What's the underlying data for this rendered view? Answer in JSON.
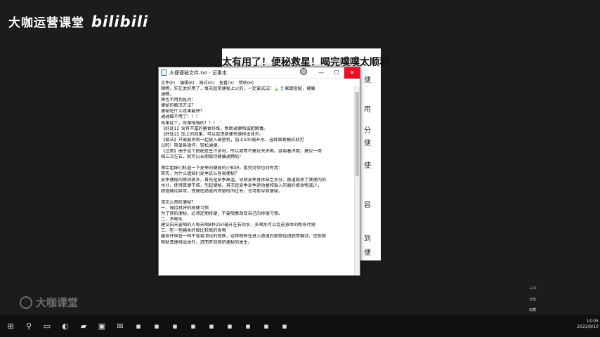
{
  "brand": {
    "channel": "大咖运营课堂",
    "site": "bilibili"
  },
  "background_doc": {
    "title": "太有用了！便秘救星！喝完噗噗太顺利",
    "side_chars": [
      "便",
      "用",
      "分",
      "便",
      "使",
      "容",
      "到",
      "便"
    ]
  },
  "notepad": {
    "title": "大便便秘文件.txt - 记事本",
    "window_controls": [
      "—",
      "☐",
      "✕"
    ],
    "menu": [
      "文件(F)",
      "编辑(E)",
      "格式(O)",
      "查看(V)",
      "帮助(H)"
    ],
    "lines": [
      "顺畅，实在太好用了，每天超常便秘上火的，一定要试试！🍃🥤果蔬搭配，健康",
      "通畅。",
      "再也不用到处问：",
      "便秘的解决方法？",
      "便秘吃什么效果最快？",
      "通通都不用了！！！",
      "效果这个，效果嘎嘎的！！！",
      "【好处1】含有不富的膳食纤维，帮助通便和减肥解毒。",
      "【好处2】加上的效果，可以促进肠便快速排出体外。",
      "【做法】只需要将和一起放入破壁机，加上500毫升水，选择果蔬模式就可",
      "以啦！简单易操作，轻松通便。",
      "【注意】由于这个搭配是生冷食材，所以肠胃不建议天天喝，容易着凉哦，建议一周",
      "喝三次左右，就可以长期保持健康通畅啦！",
      "",
      "再给姐妹们科普一下夏季的便秘的小知识，看完对你也对有用：",
      "首先，为什么姐妹们夏季这么容易便秘？",
      "夏季便秘的原因很多，首先是夏季高温，导致夏季身体缺乏水分，肠道吸收了粪便内的",
      "水分，使得粪便干结，引起便秘。其次是夏季夏季运动量和摄入的高纤维食物减少，",
      "肠道蠕动异常，粪便在肠道内停留时间过长，也可能导致便秘。",
      "",
      "该怎么预防便秘？",
      "一、保持良好的排便习惯",
      "为了预防便秘，必须定期排便，不要随意改变自己的排便习惯。",
      "二、多喝水",
      "建议白天要喝的人每天喝8杯250毫升左右的水，多喝水可以促进身体的新陈代谢",
      "三、吃一些膳食纤维比较高的食物",
      "膳食纤维是一种不容易消化的物质，这种物质在进入肠道后能够促进肠胃蠕动，还能够",
      "帮助粪便排出体外，进而有效预防便秘的发生。"
    ]
  },
  "watermark": "大咖课堂",
  "notifications": [
    "+1X",
    "分享",
    "收藏"
  ],
  "taskbar": {
    "icons": [
      "windows-icon",
      "search-icon",
      "taskview-icon",
      "edge-icon",
      "folder-icon",
      "store-icon",
      "mail-icon",
      "app-icon",
      "app-icon",
      "app-icon",
      "app-icon",
      "app-icon",
      "app-icon",
      "app-icon",
      "app-icon",
      "app-icon"
    ],
    "time": "14:05",
    "date": "2023/8/10"
  }
}
